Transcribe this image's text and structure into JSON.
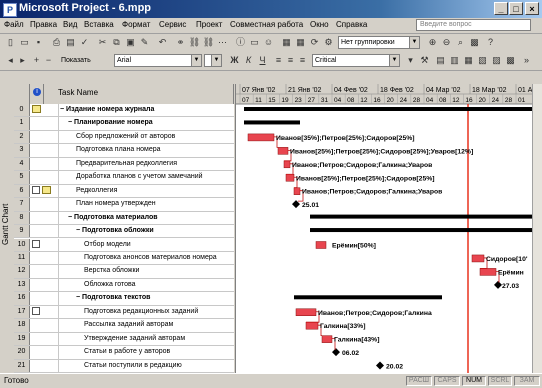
{
  "window": {
    "title": "Microsoft Project - 6.mpp"
  },
  "menu": {
    "items": [
      "Файл",
      "Правка",
      "Вид",
      "Вставка",
      "Формат",
      "Сервис",
      "Проект",
      "Совместная работа",
      "Окно",
      "Справка"
    ],
    "help_placeholder": "Введите вопрос"
  },
  "toolbar": {
    "grouping": "Нет группировки",
    "show_label": "Показать",
    "font": "Arial",
    "filter": "Critical"
  },
  "sidebar": {
    "label": "Gantt Chart"
  },
  "table": {
    "task_name_header": "Task Name"
  },
  "timeline": {
    "weeks": [
      "07 Янв '02",
      "21 Янв '02",
      "04 Фев '02",
      "18 Фев '02",
      "04 Мар '02",
      "18 Мар '02",
      "01 Ап"
    ],
    "days": [
      "07",
      "11",
      "15",
      "19",
      "23",
      "27",
      "31",
      "04",
      "08",
      "12",
      "16",
      "20",
      "24",
      "28",
      "04",
      "08",
      "12",
      "16",
      "20",
      "24",
      "28",
      "01"
    ]
  },
  "tasks": [
    {
      "id": "0",
      "name": "Издание номера журнала",
      "bold": true,
      "indent": 0,
      "icon": "note"
    },
    {
      "id": "1",
      "name": "Планирование номера",
      "bold": true,
      "indent": 1,
      "icon": ""
    },
    {
      "id": "2",
      "name": "Сбор предложений от авторов",
      "bold": false,
      "indent": 2,
      "icon": ""
    },
    {
      "id": "3",
      "name": "Подготовка плана номера",
      "bold": false,
      "indent": 2,
      "icon": ""
    },
    {
      "id": "4",
      "name": "Предварительная редколлегия",
      "bold": false,
      "indent": 2,
      "icon": ""
    },
    {
      "id": "5",
      "name": "Доработка планов с учетом замечаний",
      "bold": false,
      "indent": 2,
      "icon": ""
    },
    {
      "id": "6",
      "name": "Редколлегия",
      "bold": false,
      "indent": 2,
      "icon": "cal-note"
    },
    {
      "id": "7",
      "name": "План номера утвержден",
      "bold": false,
      "indent": 2,
      "icon": ""
    },
    {
      "id": "8",
      "name": "Подготовка материалов",
      "bold": true,
      "indent": 1,
      "icon": ""
    },
    {
      "id": "9",
      "name": "Подготовка обложки",
      "bold": true,
      "indent": 2,
      "icon": ""
    },
    {
      "id": "10",
      "name": "Отбор модели",
      "bold": false,
      "indent": 3,
      "icon": "cal"
    },
    {
      "id": "11",
      "name": "Подготовка анонсов материалов номера",
      "bold": false,
      "indent": 3,
      "icon": ""
    },
    {
      "id": "12",
      "name": "Верстка обложки",
      "bold": false,
      "indent": 3,
      "icon": ""
    },
    {
      "id": "13",
      "name": "Обложка готова",
      "bold": false,
      "indent": 3,
      "icon": ""
    },
    {
      "id": "16",
      "name": "Подготовка текстов",
      "bold": true,
      "indent": 2,
      "icon": ""
    },
    {
      "id": "17",
      "name": "Подготовка редакционных заданий",
      "bold": false,
      "indent": 3,
      "icon": "cal"
    },
    {
      "id": "18",
      "name": "Рассылка заданий авторам",
      "bold": false,
      "indent": 3,
      "icon": ""
    },
    {
      "id": "19",
      "name": "Утверждение заданий авторам",
      "bold": false,
      "indent": 3,
      "icon": ""
    },
    {
      "id": "20",
      "name": "Статьи в работе у авторов",
      "bold": false,
      "indent": 3,
      "icon": ""
    },
    {
      "id": "21",
      "name": "Статьи поступили в редакцию",
      "bold": false,
      "indent": 3,
      "icon": ""
    }
  ],
  "gantt_labels": [
    {
      "row": 2,
      "text": "Иванов[35%];Петров[25%];Сидоров[25%]"
    },
    {
      "row": 3,
      "text": "Иванов[25%];Петров[25%];Сидоров[25%];Уваров[12%]"
    },
    {
      "row": 4,
      "text": "Иванов;Петров;Сидоров;Галкина;Уваров"
    },
    {
      "row": 5,
      "text": "Иванов[25%];Петров[25%];Сидоров[25%]"
    },
    {
      "row": 6,
      "text": "Иванов;Петров;Сидоров;Галкина;Уваров"
    },
    {
      "row": 7,
      "text": "25.01"
    },
    {
      "row": 10,
      "text": "Ерёмин[50%]"
    },
    {
      "row": 11,
      "text": "Сидоров[10'"
    },
    {
      "row": 12,
      "text": "Ерёмин"
    },
    {
      "row": 13,
      "text": "27.03"
    },
    {
      "row": 15,
      "text": "Иванов;Петров;Сидоров;Галкина"
    },
    {
      "row": 16,
      "text": "Галкина[33%]"
    },
    {
      "row": 17,
      "text": "Галкина[43%]"
    },
    {
      "row": 18,
      "text": "06.02"
    },
    {
      "row": 19,
      "text": "20.02"
    }
  ],
  "status": {
    "ready": "Готово",
    "indicators": [
      "РАСШ",
      "CAPS",
      "NUM",
      "SCRL",
      "ЗАМ"
    ],
    "active": [
      "NUM"
    ]
  }
}
